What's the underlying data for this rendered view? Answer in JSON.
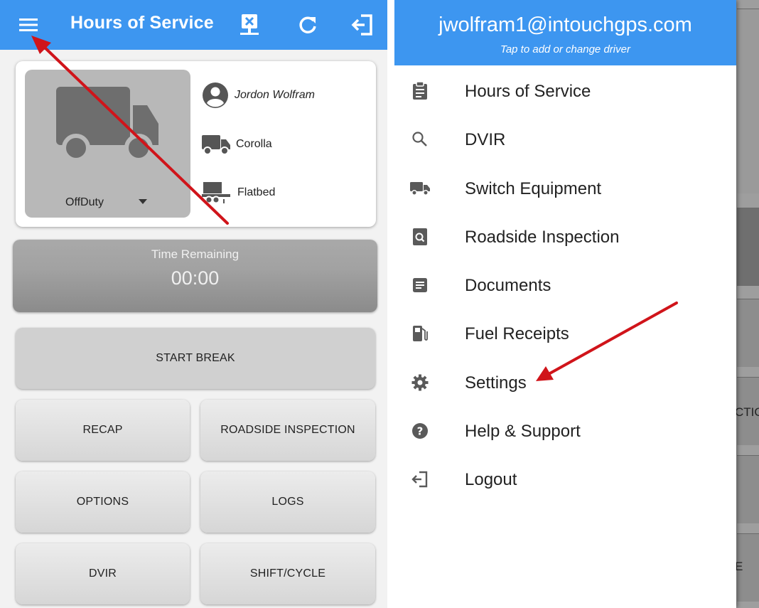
{
  "left": {
    "appbar": {
      "title": "Hours of Service",
      "menu_icon": "hamburger-menu-icon",
      "actions": [
        "sync-error-icon",
        "refresh-icon",
        "logout-icon"
      ]
    },
    "driver": {
      "status": "OffDuty",
      "name": "Jordon Wolfram",
      "vehicle": "Corolla",
      "trailer": "Flatbed"
    },
    "time_remaining": {
      "label": "Time Remaining",
      "value": "00:00"
    },
    "buttons": {
      "start_break": "START BREAK",
      "recap": "RECAP",
      "roadside_inspection": "ROADSIDE INSPECTION",
      "options": "OPTIONS",
      "logs": "LOGS",
      "dvir": "DVIR",
      "shift_cycle": "SHIFT/CYCLE"
    }
  },
  "right": {
    "drawer": {
      "email": "jwolfram1@intouchgps.com",
      "subtitle": "Tap to add or change driver",
      "items": [
        {
          "label": "Hours of Service",
          "icon": "clipboard-icon"
        },
        {
          "label": "DVIR",
          "icon": "search-icon"
        },
        {
          "label": "Switch Equipment",
          "icon": "truck-icon"
        },
        {
          "label": "Roadside Inspection",
          "icon": "inspection-icon"
        },
        {
          "label": "Documents",
          "icon": "document-icon"
        },
        {
          "label": "Fuel Receipts",
          "icon": "fuel-pump-icon"
        },
        {
          "label": "Settings",
          "icon": "gear-icon"
        },
        {
          "label": "Help & Support",
          "icon": "help-icon"
        },
        {
          "label": "Logout",
          "icon": "logout-icon"
        }
      ]
    },
    "background_fragments": [
      "CTIO",
      "E"
    ]
  },
  "colors": {
    "primary": "#3d96f0",
    "annotation_arrow": "#d0141a",
    "icon_gray": "#5a5a5a"
  }
}
